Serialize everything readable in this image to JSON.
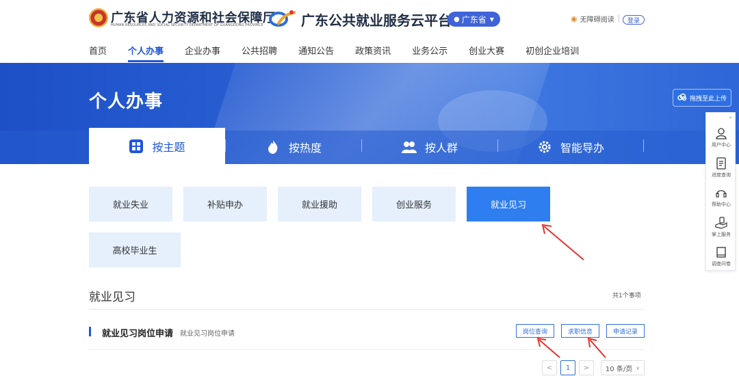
{
  "header": {
    "org_title": "广东省人力资源和社会保障厅",
    "org_subtitle": "HUMAN RESOURCES AND SOCIAL SECURITY DEPARTMENT OF GUANGDONG PROVINCE",
    "platform_title": "广东公共就业服务云平台",
    "region": "广东省",
    "accessibility": "无障碍阅读",
    "login": "登录"
  },
  "nav": {
    "items": [
      "首页",
      "个人办事",
      "企业办事",
      "公共招聘",
      "通知公告",
      "政策资讯",
      "业务公示",
      "创业大赛",
      "初创企业培训"
    ],
    "active_index": 1
  },
  "banner": {
    "title": "个人办事",
    "tabs": [
      {
        "label": "按主题",
        "icon": "grid-icon",
        "active": true
      },
      {
        "label": "按热度",
        "icon": "flame-icon",
        "active": false
      },
      {
        "label": "按人群",
        "icon": "people-icon",
        "active": false
      },
      {
        "label": "智能导办",
        "icon": "gear-icon",
        "active": false
      }
    ],
    "upload_label": "拖拽至此上传"
  },
  "sidebar": {
    "items": [
      {
        "label": "用户中心",
        "icon": "user-icon"
      },
      {
        "label": "进度查询",
        "icon": "document-icon"
      },
      {
        "label": "帮助中心",
        "icon": "headset-icon"
      },
      {
        "label": "掌上服务",
        "icon": "hand-icon"
      },
      {
        "label": "调查问卷",
        "icon": "book-icon"
      }
    ]
  },
  "topics": {
    "items": [
      "就业失业",
      "补贴申办",
      "就业援助",
      "创业服务",
      "就业见习",
      "高校毕业生"
    ],
    "active_index": 4
  },
  "section": {
    "title": "就业见习",
    "count": "共1个事项",
    "item": {
      "name": "就业见习岗位申请",
      "description": "就业见习岗位申请",
      "actions": [
        "岗位查询",
        "求职信息",
        "申请记录"
      ]
    }
  },
  "pagination": {
    "prev": "<",
    "current_page": "1",
    "next": ">",
    "page_size": "10 条/页"
  },
  "colors": {
    "accent": "#1d56d8",
    "topic_bg": "#e5f0fc",
    "topic_active": "#2f7ef0",
    "annotation_arrow": "#e8312c"
  }
}
